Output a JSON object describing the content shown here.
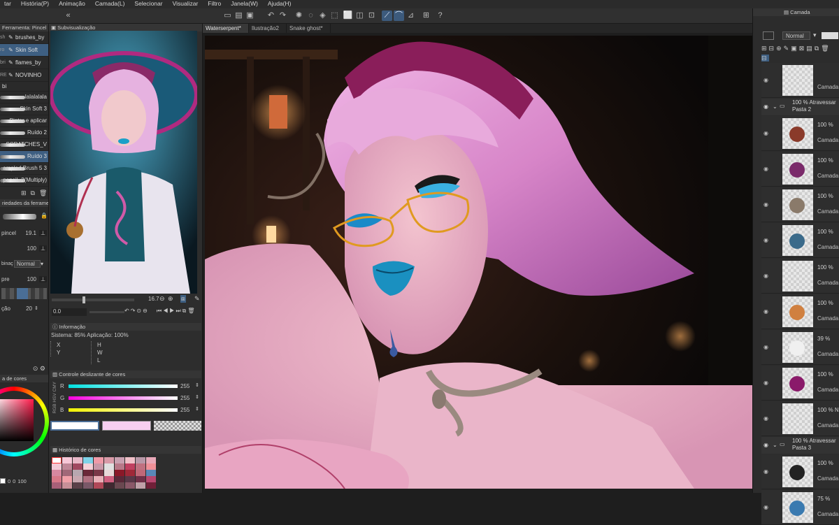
{
  "menu": [
    "tar",
    "História(P)",
    "Animação",
    "Camada(L)",
    "Selecionar",
    "Visualizar",
    "Filtro",
    "Janela(W)",
    "Ajuda(H)"
  ],
  "tool_panel": {
    "header": "Ferramenta: Pincel",
    "sub_tools": [
      {
        "left": "sh",
        "label": "brushes_by"
      },
      {
        "left": "ro",
        "label": "Skin Soft"
      },
      {
        "left": "bri",
        "label": "flames_by"
      },
      {
        "left": "RE",
        "label": "NOVINHO"
      }
    ],
    "bi_label": "bi",
    "brushes": [
      "lalalalala",
      "Skin Soft 3",
      "Pintar e aplicar",
      "Ruído 2",
      "SCRATCHES_V",
      "Ruído 3",
      "ampled Brush 5 3",
      "pencil -2(Multiply)"
    ]
  },
  "tool_properties": {
    "header": "riedades da ferrament",
    "size_label": "pincel",
    "size_value": "19.1",
    "opacity_value": "100",
    "blend_label": "binaç",
    "blend_value": "Normal",
    "density_label": "pre",
    "density_value": "100",
    "stab_label": "ção",
    "stab_value": "20"
  },
  "color_wheel_label": "a de cores",
  "color_values": {
    "h": "0",
    "s": "0",
    "v": "100"
  },
  "subview": {
    "header": "Subvisualização",
    "zoom": "16.7",
    "rotation": "0.0"
  },
  "info": {
    "header": "Informação",
    "system": "Sistema: 85%",
    "app": "Aplicação: 100%",
    "x": "X",
    "y": "Y",
    "h": "H",
    "w": "W",
    "l": "L"
  },
  "color_slider": {
    "header": "Controle deslizante de cores",
    "modes": [
      "RGB",
      "HSV",
      "CMY"
    ],
    "channels": [
      {
        "name": "R",
        "value": "255"
      },
      {
        "name": "G",
        "value": "255"
      },
      {
        "name": "B",
        "value": "255"
      }
    ]
  },
  "color_history": {
    "header": "Histórico de cores",
    "colors": [
      "#ffffff",
      "#f7c8d8",
      "#e8b8c8",
      "#7fd3e8",
      "#ef9aa8",
      "#d89aa8",
      "#c8a0b0",
      "#f0c0c8",
      "#b898a8",
      "#e8a8b8",
      "#f2cad6",
      "#c08898",
      "#a04860",
      "#f4d0d8",
      "#c898a8",
      "#e0e0e0",
      "#b87888",
      "#c04060",
      "#c07080",
      "#f09098",
      "#d888a0",
      "#a06878",
      "#b8a8b0",
      "#6a2838",
      "#7a3848",
      "#e8d8d8",
      "#8a1828",
      "#a02838",
      "#c06878",
      "#5a88b8",
      "#d87888",
      "#f0a0a8",
      "#c8a8b0",
      "#b07080",
      "#e8b0b8",
      "#d06080",
      "#5a2838",
      "#5a3848",
      "#703048",
      "#b84870",
      "#a86078",
      "#c89098",
      "#5a4048",
      "#7a5868",
      "#b04858",
      "#402830",
      "#6a4850",
      "#8a5868",
      "#c0a0a8",
      "#702038"
    ]
  },
  "document_tabs": [
    "Waterserpent*",
    "Ilustração2",
    "Snake ghost*"
  ],
  "layer_panel": {
    "header": "Camada",
    "blend_mode": "Normal",
    "layers": [
      {
        "kind": "layer",
        "pct": "",
        "name": "Camada"
      },
      {
        "kind": "folder",
        "pct": "100 % Atravessar",
        "name": "Pasta 2"
      },
      {
        "kind": "layer",
        "pct": "100 %",
        "name": "Camada"
      },
      {
        "kind": "layer",
        "pct": "100 %",
        "name": "Camada"
      },
      {
        "kind": "layer",
        "pct": "100 %",
        "name": "Camada"
      },
      {
        "kind": "layer",
        "pct": "100 %",
        "name": "Camada"
      },
      {
        "kind": "layer",
        "pct": "100 %",
        "name": "Camada"
      },
      {
        "kind": "layer",
        "pct": "100 %",
        "name": "Camada"
      },
      {
        "kind": "layer",
        "pct": "39 %",
        "name": "Camada"
      },
      {
        "kind": "layer",
        "pct": "100 %",
        "name": "Camada"
      },
      {
        "kind": "layer",
        "pct": "100 % No",
        "name": "Camada"
      },
      {
        "kind": "folder",
        "pct": "100 % Atravessar",
        "name": "Pasta 3"
      },
      {
        "kind": "layer",
        "pct": "100 %",
        "name": "Camada"
      },
      {
        "kind": "layer",
        "pct": "75 %",
        "name": "Camada"
      }
    ]
  },
  "colors": {
    "selection_blue": "#3e5f82",
    "panel_bg": "#2c2c2c",
    "accent_pink": "#e9a6d8",
    "lip_blue": "#2aa4d0"
  }
}
